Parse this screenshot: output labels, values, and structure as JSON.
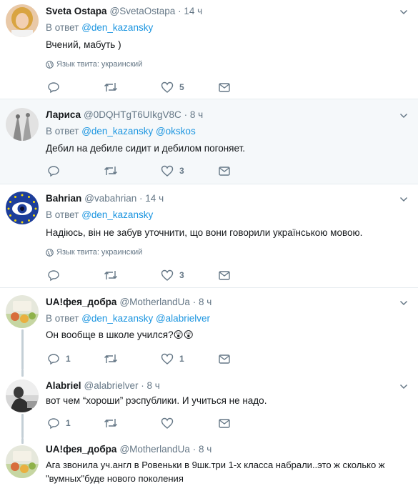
{
  "ui": {
    "reply_prefix": "В ответ",
    "lang_label": "Язык твита: украинский",
    "dot": "·"
  },
  "tweets": [
    {
      "name": "Sveta Ostapa",
      "handle": "@SvetaOstapa",
      "time": "14 ч",
      "reply_to": [
        "@den_kazansky"
      ],
      "lines": [
        "Вчений, мабуть )"
      ],
      "lang": true,
      "replies": "",
      "retweets": "",
      "likes": "5"
    },
    {
      "name": "Лариса",
      "handle": "@0DQHTgT6UIkgV8C",
      "time": "8 ч",
      "reply_to": [
        "@den_kazansky",
        "@okskos"
      ],
      "lines": [
        "Дебил на дебиле сидит и дебилом погоняет."
      ],
      "lang": false,
      "replies": "",
      "retweets": "",
      "likes": "3"
    },
    {
      "name": "Bahrian",
      "handle": "@vabahrian",
      "time": "14 ч",
      "reply_to": [
        "@den_kazansky"
      ],
      "lines": [
        "Надіюсь, він не забув уточнити, що вони говорили українською мовою."
      ],
      "lang": true,
      "replies": "",
      "retweets": "",
      "likes": "3"
    },
    {
      "name": "UA!фея_добра",
      "handle": "@MotherlandUa",
      "time": "8 ч",
      "reply_to": [
        "@den_kazansky",
        "@alabrielver"
      ],
      "lines": [
        "Он вообще в школе учился?😲😲"
      ],
      "lang": false,
      "replies": "1",
      "retweets": "",
      "likes": "1"
    },
    {
      "name": "Alabriel",
      "handle": "@alabrielver",
      "time": "8 ч",
      "reply_to": [],
      "lines": [
        "вот чем “хороши” рэспублики. И учиться не надо."
      ],
      "lang": false,
      "replies": "1",
      "retweets": "",
      "likes": ""
    },
    {
      "name": "UA!фея_добра",
      "handle": "@MotherlandUa",
      "time": "8 ч",
      "reply_to": [],
      "lines": [
        "Ага звонила уч.англ в Ровеньки в 9шк.три 1-х класса набрали..это ж сколько ж",
        "\"вумных\"буде нового поколения"
      ],
      "lang": false,
      "replies": "",
      "retweets": "",
      "likes": ""
    }
  ]
}
